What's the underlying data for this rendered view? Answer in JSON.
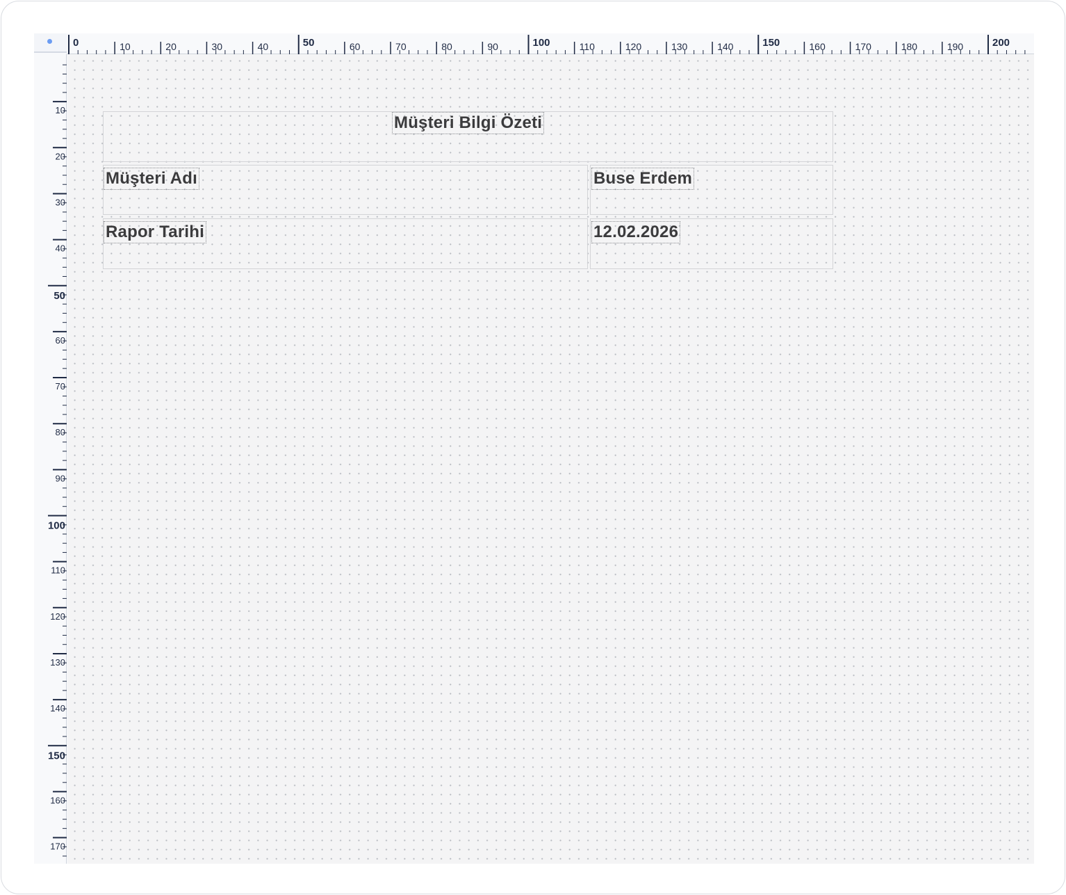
{
  "rulers": {
    "top_labels": [
      "0",
      "10",
      "20",
      "30",
      "40",
      "50",
      "60",
      "70",
      "80",
      "90",
      "100",
      "110",
      "120",
      "130",
      "140",
      "150",
      "160",
      "170",
      "180",
      "190",
      "200"
    ],
    "left_labels": [
      "10",
      "20",
      "30",
      "40",
      "50",
      "60",
      "70",
      "80",
      "90",
      "100",
      "110",
      "120",
      "130",
      "140",
      "150",
      "160",
      "170"
    ]
  },
  "report": {
    "title": "Müşteri Bilgi Özeti",
    "rows": [
      {
        "label": "Müşteri Adı",
        "value": "Buse Erdem"
      },
      {
        "label": "Rapor Tarihi",
        "value": "12.02.2026"
      }
    ]
  },
  "colors": {
    "accent_dot": "#6b9cf2",
    "ruler_text": "#1f2a44",
    "canvas_bg": "#f4f4f5",
    "grid_dot": "#b9bcc2"
  }
}
